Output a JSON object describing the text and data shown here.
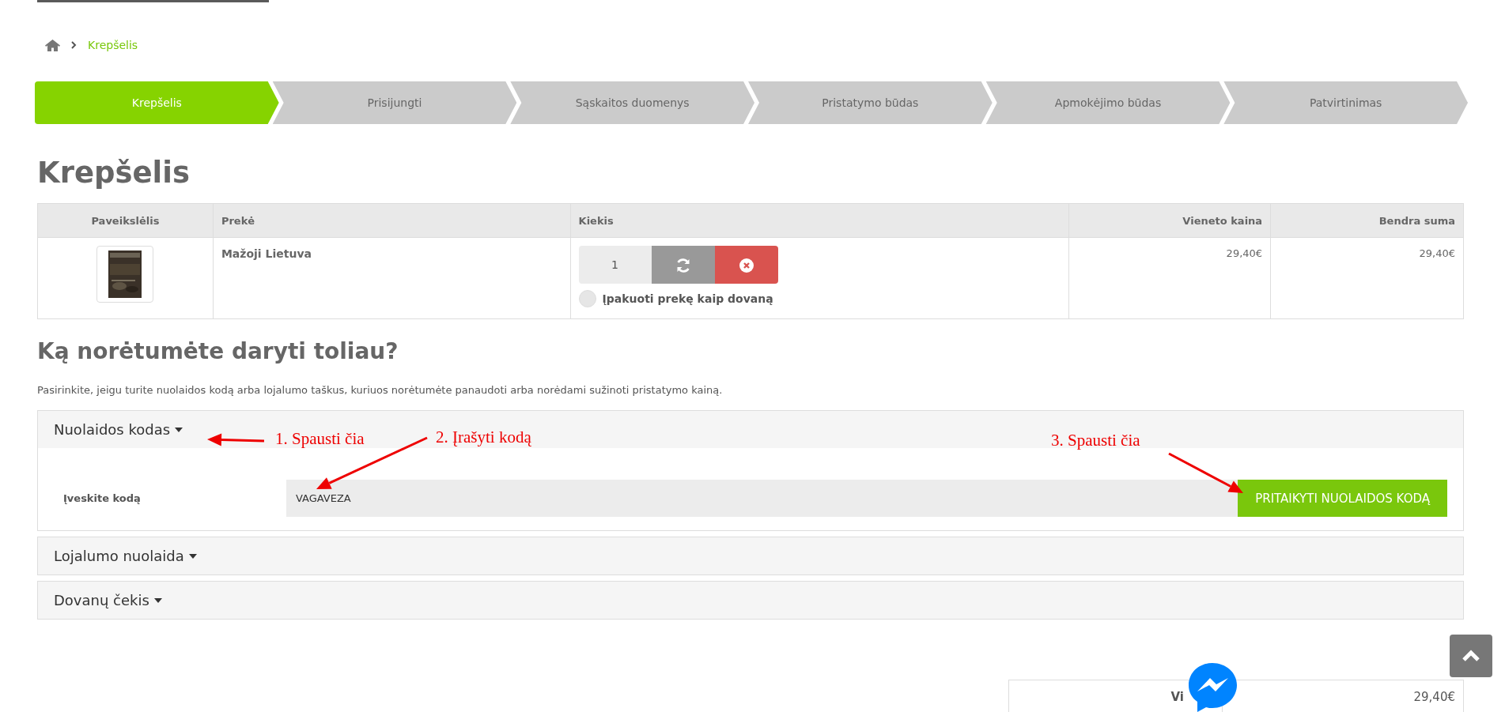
{
  "breadcrumb": [
    {
      "label": "Krepšelis"
    }
  ],
  "steps": [
    {
      "label": "Krepšelis",
      "selected": true
    },
    {
      "label": "Prisijungti",
      "selected": false
    },
    {
      "label": "Sąskaitos duomenys",
      "selected": false
    },
    {
      "label": "Pristatymo būdas",
      "selected": false
    },
    {
      "label": "Apmokėjimo būdas",
      "selected": false
    },
    {
      "label": "Patvirtinimas",
      "selected": false
    }
  ],
  "title": "Krepšelis",
  "cart_table": {
    "columns": [
      "Paveikslėlis",
      "Prekė",
      "Kiekis",
      "Vieneto kaina",
      "Bendra suma"
    ],
    "rows": [
      {
        "product": "Mažoji Lietuva",
        "quantity": "1",
        "gift_wrap": {
          "label": "Įpakuoti prekę kaip dovaną",
          "checked": false
        },
        "unit_price": "29,40€",
        "total": "29,40€"
      }
    ]
  },
  "next_title": "Ką norėtumėte daryti toliau?",
  "next_text": "Pasirinkite, jeigu turite nuolaidos kodą arba lojalumo taškus, kuriuos norėtumėte panaudoti arba norėdami sužinoti pristatymo kainą.",
  "sections": [
    {
      "title": "Nuolaidos kodas",
      "expanded": true,
      "field_label": "Įveskite kodą",
      "value": "VAGAVEZA",
      "button": "PRITAIKYTI NUOLAIDOS KODĄ"
    },
    {
      "title": "Lojalumo nuolaida",
      "expanded": false
    },
    {
      "title": "Dovanų čekis",
      "expanded": false
    }
  ],
  "summary": [
    {
      "label": "Vi",
      "value": "29,40€"
    }
  ],
  "annotations": [
    {
      "text": "1. Spausti čia"
    },
    {
      "text": "2. Įrašyti kodą"
    },
    {
      "text": "3. Spausti čia"
    }
  ]
}
